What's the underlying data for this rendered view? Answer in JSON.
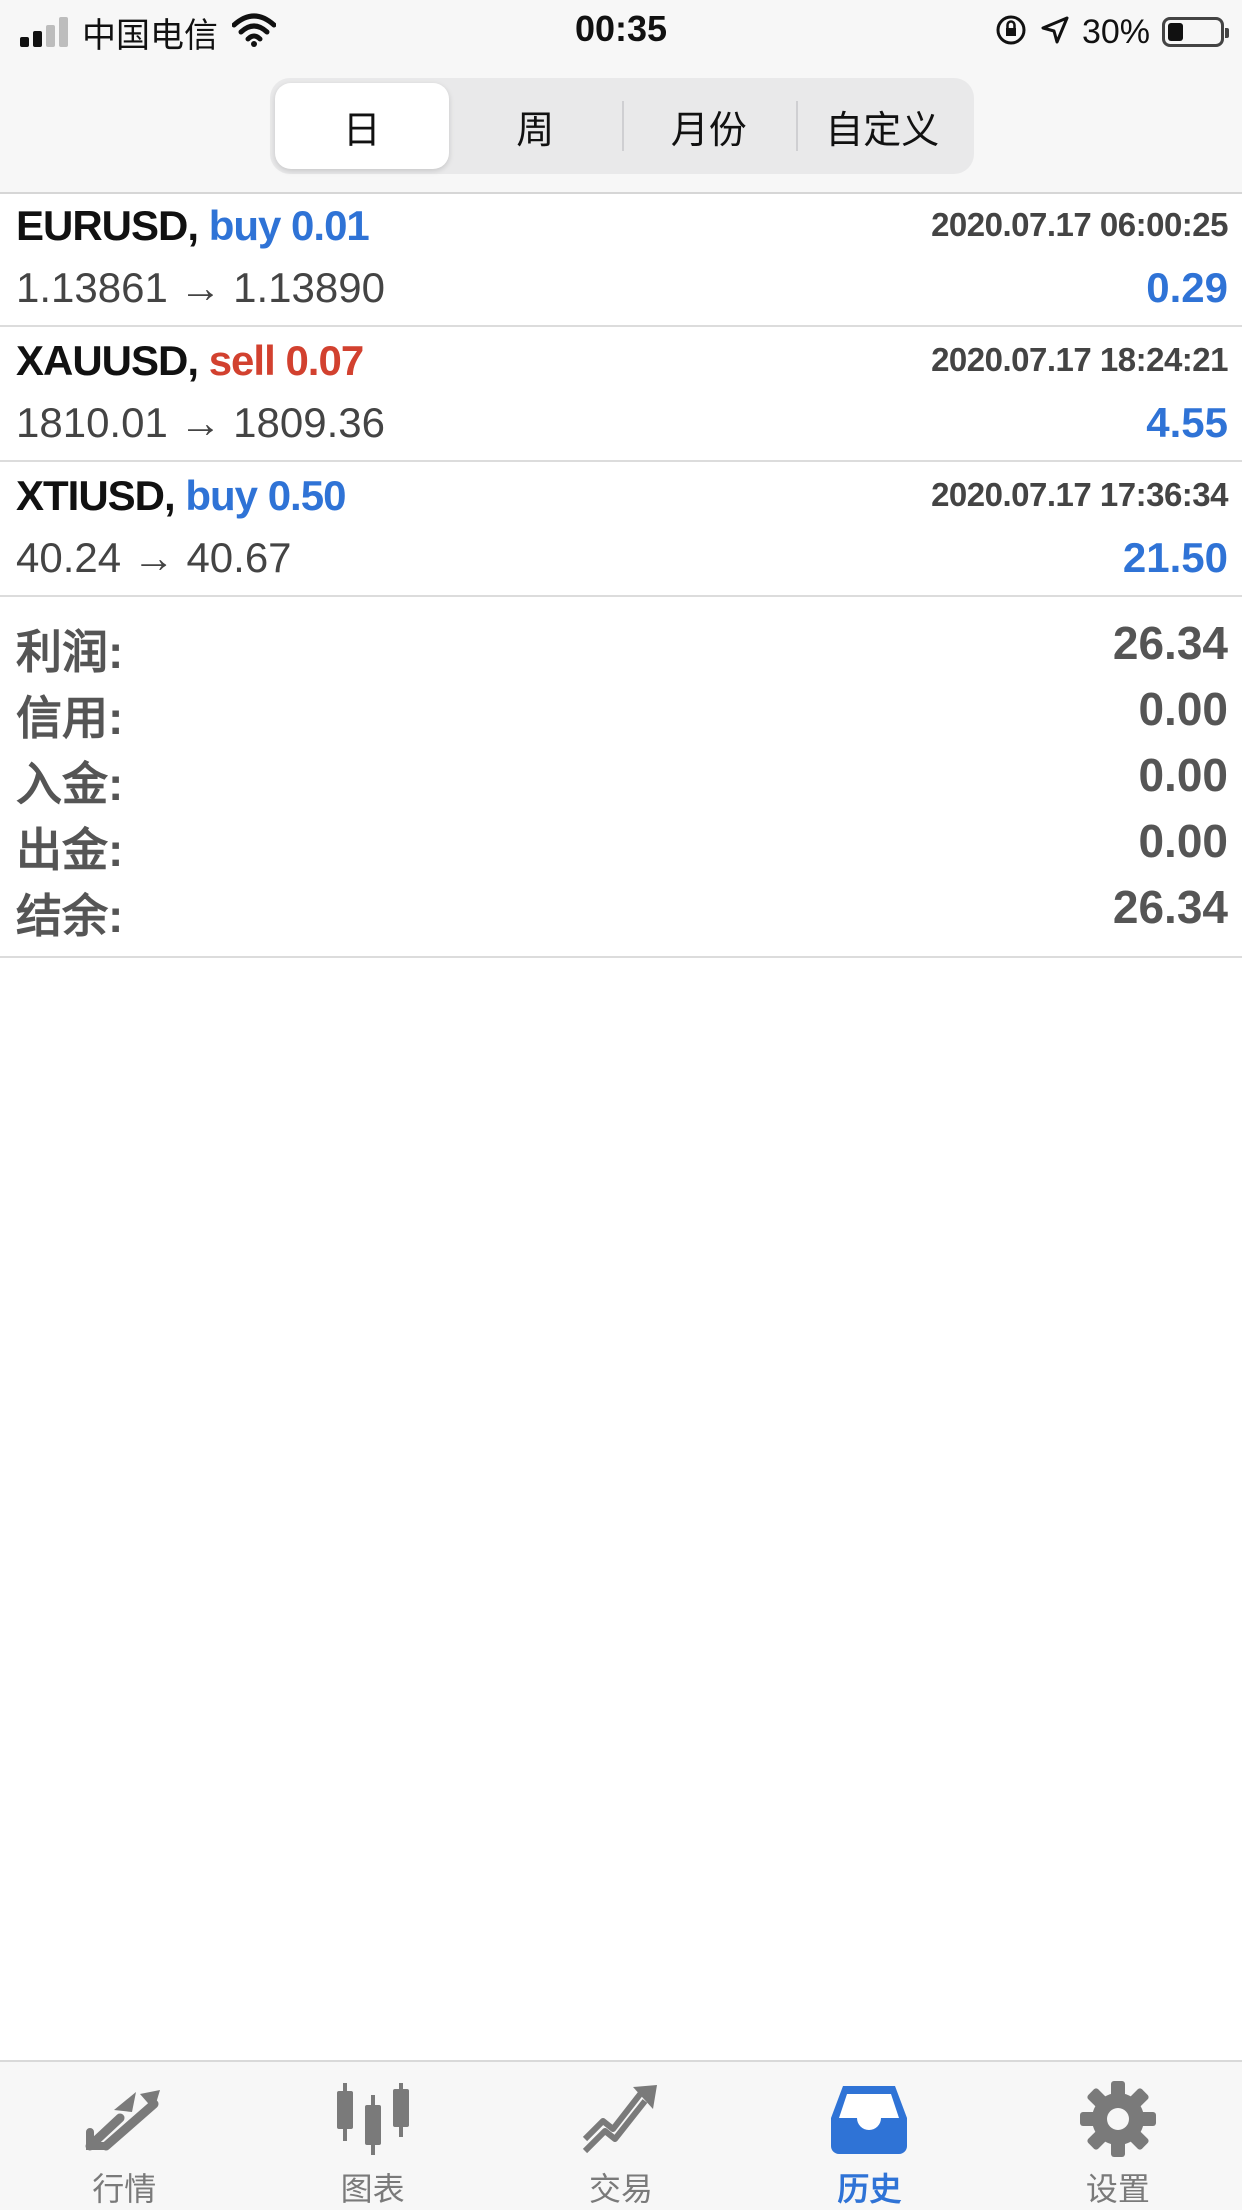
{
  "status_bar": {
    "carrier": "中国电信",
    "time": "00:35",
    "battery": "30%",
    "battery_level": 0.3
  },
  "period_tabs": [
    {
      "label": "日",
      "active": true
    },
    {
      "label": "周",
      "active": false
    },
    {
      "label": "月份",
      "active": false
    },
    {
      "label": "自定义",
      "active": false
    }
  ],
  "trades": [
    {
      "symbol": "EURUSD,",
      "direction": "buy",
      "volume": "0.01",
      "time": "2020.07.17 06:00:25",
      "prices": "1.13861 → 1.13890",
      "profit": "0.29"
    },
    {
      "symbol": "XAUUSD,",
      "direction": "sell",
      "volume": "0.07",
      "time": "2020.07.17 18:24:21",
      "prices": "1810.01 → 1809.36",
      "profit": "4.55"
    },
    {
      "symbol": "XTIUSD,",
      "direction": "buy",
      "volume": "0.50",
      "time": "2020.07.17 17:36:34",
      "prices": "40.24 → 40.67",
      "profit": "21.50"
    }
  ],
  "summary": [
    {
      "label": "利润:",
      "value": "26.34"
    },
    {
      "label": "信用:",
      "value": "0.00"
    },
    {
      "label": "入金:",
      "value": "0.00"
    },
    {
      "label": "出金:",
      "value": "0.00"
    },
    {
      "label": "结余:",
      "value": "26.34"
    }
  ],
  "tab_bar": [
    {
      "label": "行情",
      "icon": "quotes-arrows-icon",
      "active": false
    },
    {
      "label": "图表",
      "icon": "candlestick-chart-icon",
      "active": false
    },
    {
      "label": "交易",
      "icon": "trade-trend-icon",
      "active": false
    },
    {
      "label": "历史",
      "icon": "history-inbox-icon",
      "active": true
    },
    {
      "label": "设置",
      "icon": "gear-icon",
      "active": false
    }
  ],
  "colors": {
    "accent": "#2f73d6",
    "sell": "#d2412f",
    "inactive": "#7a7a7a"
  }
}
